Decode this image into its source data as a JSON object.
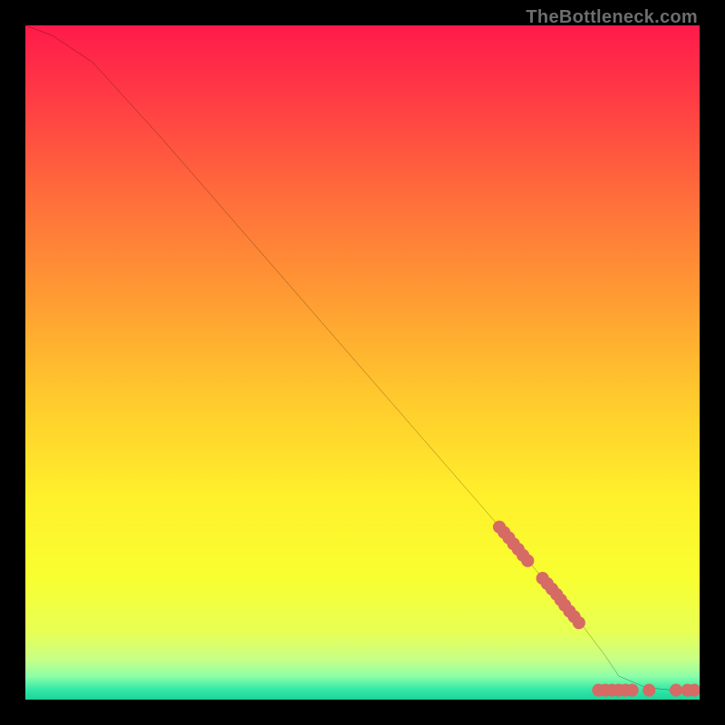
{
  "watermark": "TheBottleneck.com",
  "chart_data": {
    "type": "line",
    "title": "",
    "xlabel": "",
    "ylabel": "",
    "xlim": [
      0,
      100
    ],
    "ylim": [
      0,
      100
    ],
    "background_gradient_stops": [
      {
        "stop": 0.0,
        "color": "#ff1a4a"
      },
      {
        "stop": 0.1,
        "color": "#ff3945"
      },
      {
        "stop": 0.25,
        "color": "#ff6c3b"
      },
      {
        "stop": 0.4,
        "color": "#ff9a33"
      },
      {
        "stop": 0.55,
        "color": "#ffc92d"
      },
      {
        "stop": 0.7,
        "color": "#fff02b"
      },
      {
        "stop": 0.82,
        "color": "#f8ff31"
      },
      {
        "stop": 0.9,
        "color": "#e7ff55"
      },
      {
        "stop": 0.94,
        "color": "#c8ff86"
      },
      {
        "stop": 0.965,
        "color": "#8effa8"
      },
      {
        "stop": 0.985,
        "color": "#33e8a7"
      },
      {
        "stop": 1.0,
        "color": "#1dd39a"
      }
    ],
    "series": [
      {
        "name": "curve",
        "color": "#000000",
        "x": [
          0,
          4,
          10,
          20,
          30,
          40,
          50,
          60,
          70,
          78,
          83,
          86,
          88,
          92,
          96,
          100
        ],
        "y": [
          100,
          98.5,
          94.5,
          83.5,
          72,
          60.5,
          49,
          37.5,
          26,
          16.5,
          10.5,
          6.5,
          3.5,
          1.8,
          1.4,
          1.2
        ]
      }
    ],
    "scatter_clusters": [
      {
        "name": "upper-dots",
        "color": "#d66a65",
        "points": [
          {
            "x": 70.3,
            "y": 25.6
          },
          {
            "x": 71.0,
            "y": 24.8
          },
          {
            "x": 71.7,
            "y": 24.0
          },
          {
            "x": 72.4,
            "y": 23.1
          },
          {
            "x": 73.1,
            "y": 22.3
          },
          {
            "x": 73.8,
            "y": 21.4
          },
          {
            "x": 74.5,
            "y": 20.6
          }
        ]
      },
      {
        "name": "mid-dots",
        "color": "#d66a65",
        "points": [
          {
            "x": 76.7,
            "y": 18.0
          },
          {
            "x": 77.4,
            "y": 17.2
          },
          {
            "x": 78.1,
            "y": 16.4
          },
          {
            "x": 78.8,
            "y": 15.6
          },
          {
            "x": 79.4,
            "y": 14.8
          },
          {
            "x": 80.0,
            "y": 14.0
          },
          {
            "x": 80.7,
            "y": 13.1
          },
          {
            "x": 81.4,
            "y": 12.3
          },
          {
            "x": 82.1,
            "y": 11.4
          }
        ]
      },
      {
        "name": "base-dots",
        "color": "#d66a65",
        "points": [
          {
            "x": 85.0,
            "y": 1.4
          },
          {
            "x": 86.0,
            "y": 1.4
          },
          {
            "x": 87.0,
            "y": 1.4
          },
          {
            "x": 88.0,
            "y": 1.4
          },
          {
            "x": 89.0,
            "y": 1.4
          },
          {
            "x": 90.0,
            "y": 1.4
          },
          {
            "x": 92.5,
            "y": 1.4
          },
          {
            "x": 96.5,
            "y": 1.4
          },
          {
            "x": 98.2,
            "y": 1.4
          },
          {
            "x": 99.2,
            "y": 1.4
          }
        ]
      }
    ]
  }
}
